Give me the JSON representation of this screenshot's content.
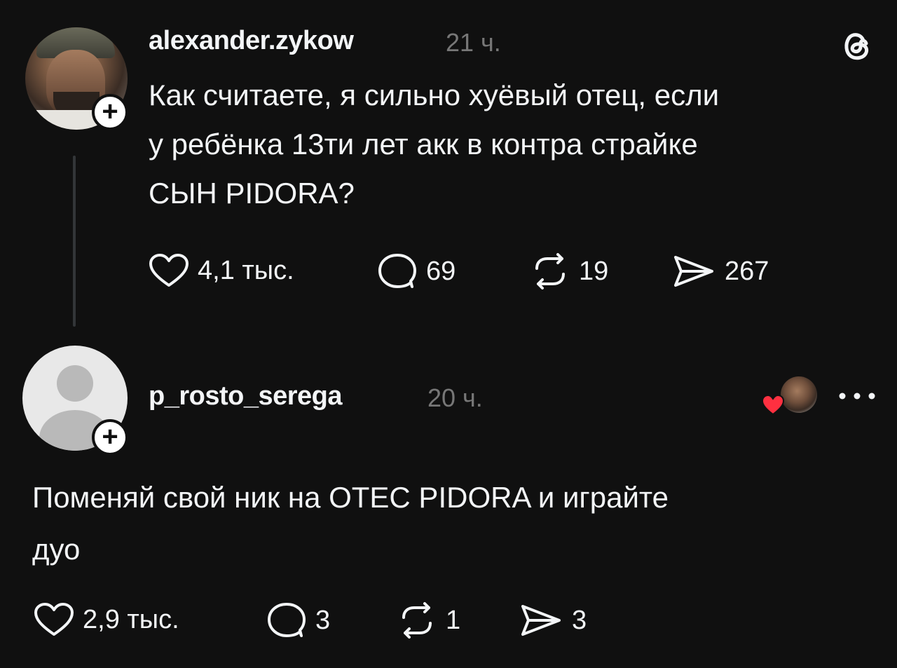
{
  "post": {
    "username": "alexander.zykow",
    "time": "21 ч.",
    "text_lines": [
      "Как считаете, я сильно хуёвый отец, если",
      "у ребёнка 13ти лет акк в контра страйке",
      "СЫН PIDORA?"
    ],
    "likes": "4,1 тыс.",
    "comments": "69",
    "reposts": "19",
    "shares": "267"
  },
  "reply": {
    "username": "p_rosto_serega",
    "time": "20 ч.",
    "text_lines": [
      "Поменяй свой ник на ОТЕС PIDORA и играйте",
      "дуо"
    ],
    "likes": "2,9 тыс.",
    "comments": "3",
    "reposts": "1",
    "shares": "3"
  },
  "icons": {
    "follow": "+",
    "like": "heart-icon",
    "comment": "comment-icon",
    "repost": "repost-icon",
    "share": "share-icon",
    "logo": "threads-logo-icon",
    "more": "more-icon"
  },
  "colors": {
    "background": "#101010",
    "text": "#f3f5f7",
    "muted": "#777777",
    "heart_red": "#ff3040"
  }
}
